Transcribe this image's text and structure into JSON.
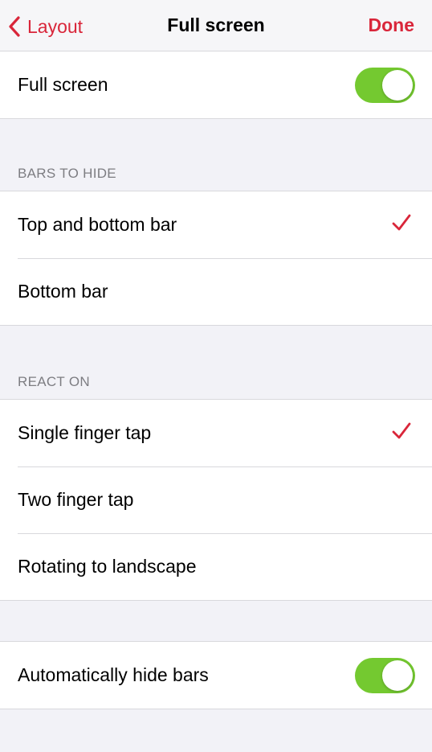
{
  "nav": {
    "back_label": "Layout",
    "title": "Full screen",
    "done_label": "Done"
  },
  "full_screen": {
    "label": "Full screen",
    "toggle_on": true
  },
  "bars_to_hide": {
    "header": "BARS TO HIDE",
    "options": [
      {
        "label": "Top and bottom bar",
        "selected": true
      },
      {
        "label": "Bottom bar",
        "selected": false
      }
    ]
  },
  "react_on": {
    "header": "REACT ON",
    "options": [
      {
        "label": "Single finger tap",
        "selected": true
      },
      {
        "label": "Two finger tap",
        "selected": false
      },
      {
        "label": "Rotating to landscape",
        "selected": false
      }
    ]
  },
  "auto_hide": {
    "label": "Automatically hide bars",
    "toggle_on": true
  },
  "colors": {
    "accent": "#d9263a",
    "toggle_on": "#74c930",
    "background": "#f2f2f7",
    "section_header": "#7d7d82"
  },
  "icons": {
    "back": "chevron-left-icon",
    "check": "checkmark-icon"
  }
}
